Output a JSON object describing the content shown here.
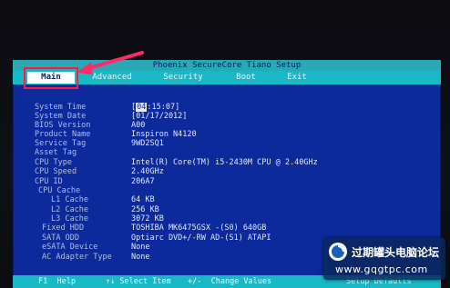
{
  "title": "Phoenix SecureCore Tiano Setup",
  "tabs": [
    "Main",
    "Advanced",
    "Security",
    "Boot",
    "Exit"
  ],
  "rows": [
    {
      "label": "System Time",
      "value": ":15:07]",
      "cursor": "04"
    },
    {
      "label": "System Date",
      "value": "[01/17/2012]"
    },
    {
      "label": "BIOS Version",
      "value": "A00"
    },
    {
      "label": "Product Name",
      "value": "Inspiron N4120"
    },
    {
      "label": "Service Tag",
      "value": "9WD2SQ1"
    },
    {
      "label": "Asset Tag",
      "value": ""
    },
    {
      "label": "CPU Type",
      "value": "Intel(R) Core(TM) i5-2430M CPU @ 2.40GHz"
    },
    {
      "label": "CPU Speed",
      "value": "2.40GHz"
    },
    {
      "label": "CPU ID",
      "value": "206A7"
    },
    {
      "label": "CPU Cache",
      "value": ""
    },
    {
      "label": "L1 Cache",
      "value": "64 KB"
    },
    {
      "label": "L2 Cache",
      "value": "256 KB"
    },
    {
      "label": "L3 Cache",
      "value": "3072 KB"
    },
    {
      "label": "Fixed HDD",
      "value": "TOSHIBA MK6475GSX    -(S0) 640GB"
    },
    {
      "label": "SATA ODD",
      "value": "Optiarc DVD+/-RW AD-(S1)  ATAPI"
    },
    {
      "label": "eSATA Device",
      "value": "None"
    },
    {
      "label": "AC Adapter Type",
      "value": "None"
    }
  ],
  "footer": {
    "f1_key": "F1",
    "f1_label": "Help",
    "nav_key": "↑↓",
    "nav_label": "Select Item",
    "pm_key": "+/-",
    "pm_label": "Change Values",
    "f9_label": "Setup Defaults"
  },
  "watermark": {
    "name": "过期罐头电脑论坛",
    "url": "www.gqgtpc.com"
  },
  "colors": {
    "bios_bg": "#0d2a9c",
    "menubar": "#18b8c4",
    "highlight": "#ff1a3c"
  }
}
